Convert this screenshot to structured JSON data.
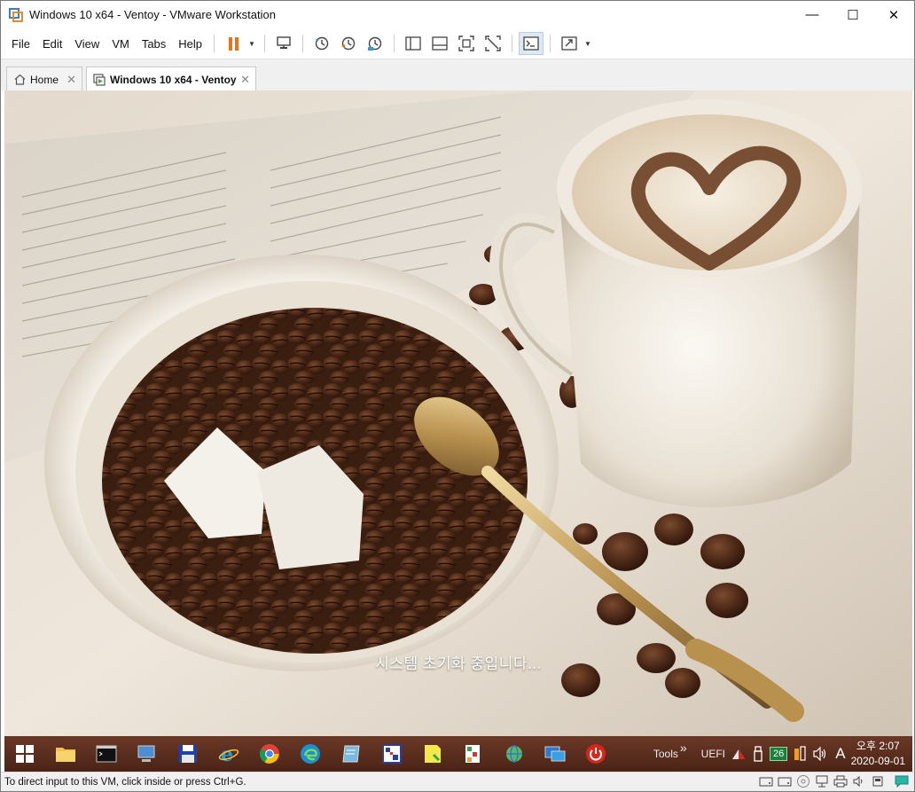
{
  "window": {
    "title": "Windows 10 x64 - Ventoy - VMware Workstation"
  },
  "controls": {
    "minimize": "—",
    "maximize": "☐",
    "close": "✕"
  },
  "menu": [
    {
      "label": "File"
    },
    {
      "label": "Edit"
    },
    {
      "label": "View"
    },
    {
      "label": "VM"
    },
    {
      "label": "Tabs"
    },
    {
      "label": "Help"
    }
  ],
  "tabs": {
    "home": {
      "label": "Home",
      "icon": "home-icon"
    },
    "vm": {
      "label": "Windows 10 x64 - Ventoy",
      "icon": "vm-icon"
    },
    "close_glyph": "✕"
  },
  "guest": {
    "status_message": "시스템 초기화 중입니다...",
    "taskbar": {
      "tools_label": "Tools",
      "overflow_glyph": "»",
      "uefi_label": "UEFI",
      "badge_number": "26",
      "ime_label": "A",
      "clock_time": "오후 2:07",
      "clock_date": "2020-09-01"
    }
  },
  "statusbar": {
    "hint": "To direct input to this VM, click inside or press Ctrl+G."
  },
  "colors": {
    "accent_orange": "#e8731a",
    "taskbar_brown": "#5a2d1c",
    "tab_active": "#ffffff"
  }
}
